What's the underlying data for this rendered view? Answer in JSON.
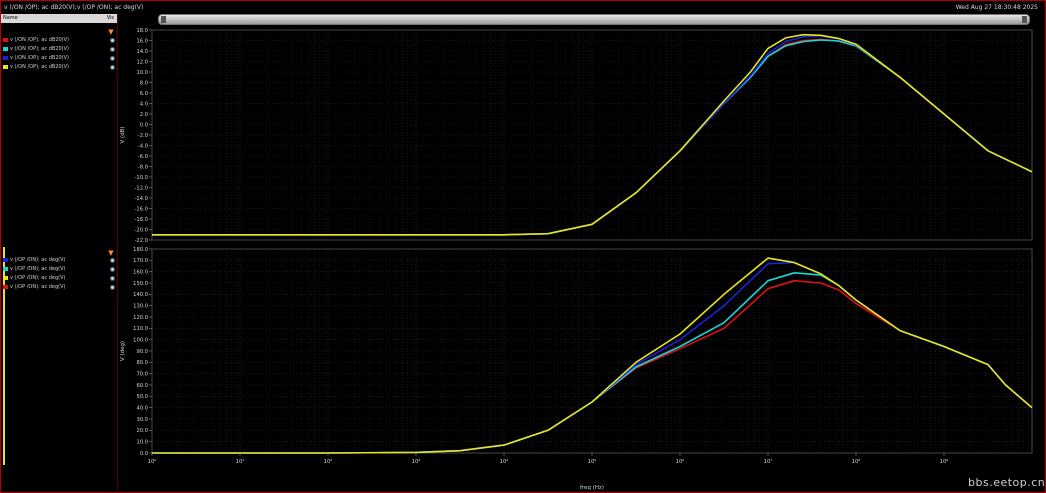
{
  "window": {
    "title": "v (/ON /OP); ac dB20(V);v (/OP /ON); ac deg(V)",
    "timestamp": "Wed Aug 27 18:30:48 2025"
  },
  "left_panel": {
    "name_header": "Name",
    "vis_header": "Vis"
  },
  "watermark": "bbs.eetop.cn",
  "legend_top": [
    {
      "label": "v (/ON /OP); ac dB20(V)",
      "color": "#e01010"
    },
    {
      "label": "v (/ON /OP); ac dB20(V)",
      "color": "#18d6d6"
    },
    {
      "label": "v (/ON /OP); ac dB20(V)",
      "color": "#1a22d8"
    },
    {
      "label": "v (/ON /OP); ac dB20(V)",
      "color": "#e6e61a"
    }
  ],
  "legend_bottom": [
    {
      "label": "v (/OP /ON); ac deg(V)",
      "color": "#1a22d8"
    },
    {
      "label": "v (/OP /ON); ac deg(V)",
      "color": "#18d6d6"
    },
    {
      "label": "v (/OP /ON); ac deg(V)",
      "color": "#e6e61a"
    },
    {
      "label": "v (/OP /ON); ac deg(V)",
      "color": "#e01010"
    }
  ],
  "chart_data": [
    {
      "type": "line",
      "ylabel": "V (dB)",
      "ylim": [
        -22,
        18
      ],
      "yticks": [
        "18.0",
        "16.0",
        "14.0",
        "12.0",
        "10.0",
        "8.0",
        "6.0",
        "4.0",
        "2.0",
        "0.0",
        "-2.0",
        "-4.0",
        "-6.0",
        "-8.0",
        "-10.0",
        "-12.0",
        "-14.0",
        "-16.0",
        "-18.0",
        "-20.0",
        "-22.0"
      ],
      "x_scale": "log",
      "xlim_exp": [
        0,
        10
      ],
      "grid": true,
      "series": [
        {
          "color": "#e01010",
          "x_exp": [
            0,
            1,
            2,
            3,
            4,
            4.5,
            5,
            5.5,
            6,
            6.5,
            6.8,
            7,
            7.2,
            7.4,
            7.6,
            7.8,
            8,
            8.5,
            9,
            9.5,
            10
          ],
          "y": [
            -21,
            -21,
            -21,
            -21,
            -21,
            -20.8,
            -19,
            -13,
            -5,
            4,
            9,
            13,
            15.2,
            16.0,
            16.2,
            15.9,
            15.0,
            9,
            2,
            -5,
            -9
          ]
        },
        {
          "color": "#18d6d6",
          "x_exp": [
            0,
            1,
            2,
            3,
            4,
            4.5,
            5,
            5.5,
            6,
            6.5,
            6.8,
            7,
            7.2,
            7.4,
            7.6,
            7.8,
            8,
            8.5,
            9,
            9.5,
            10
          ],
          "y": [
            -21,
            -21,
            -21,
            -21,
            -21,
            -20.8,
            -19,
            -13,
            -5,
            4,
            9,
            13,
            15.0,
            15.8,
            16.1,
            15.9,
            15.0,
            9,
            2,
            -5,
            -9
          ]
        },
        {
          "color": "#1a22d8",
          "x_exp": [
            0,
            1,
            2,
            3,
            4,
            4.5,
            5,
            5.5,
            6,
            6.5,
            6.8,
            7,
            7.2,
            7.4,
            7.6,
            7.8,
            8,
            8.5,
            9,
            9.5,
            10
          ],
          "y": [
            -21,
            -21,
            -21,
            -21,
            -21,
            -20.8,
            -19,
            -13,
            -5,
            4,
            9.3,
            13.5,
            15.8,
            16.7,
            16.9,
            16.3,
            15.2,
            9,
            2,
            -5,
            -9
          ]
        },
        {
          "color": "#e6e61a",
          "x_exp": [
            0,
            1,
            2,
            3,
            4,
            4.5,
            5,
            5.5,
            6,
            6.5,
            6.8,
            7,
            7.2,
            7.4,
            7.6,
            7.8,
            8,
            8.5,
            9,
            9.5,
            10
          ],
          "y": [
            -21,
            -21,
            -21,
            -21,
            -21,
            -20.8,
            -19,
            -13,
            -5,
            4.5,
            10,
            14.5,
            16.5,
            17.1,
            17.0,
            16.4,
            15.3,
            9,
            2,
            -5,
            -9
          ]
        }
      ]
    },
    {
      "type": "line",
      "ylabel": "V (deg)",
      "xlabel": "freq (Hz)",
      "ylim": [
        0,
        180
      ],
      "yticks": [
        "180.0",
        "170.0",
        "160.0",
        "150.0",
        "140.0",
        "130.0",
        "120.0",
        "110.0",
        "100.0",
        "90.0",
        "80.0",
        "70.0",
        "60.0",
        "50.0",
        "40.0",
        "30.0",
        "20.0",
        "10.0",
        "0.0"
      ],
      "x_scale": "log",
      "xlim_exp": [
        0,
        10
      ],
      "xticks": [
        "10⁰",
        "10¹",
        "10²",
        "10³",
        "10⁴",
        "10⁵",
        "10⁶",
        "10⁷",
        "10⁸",
        "10⁹"
      ],
      "grid": true,
      "series": [
        {
          "color": "#e01010",
          "x_exp": [
            0,
            1,
            2,
            3,
            3.5,
            4,
            4.5,
            5,
            5.5,
            6,
            6.5,
            7,
            7.3,
            7.6,
            7.8,
            8,
            8.5,
            9,
            9.5,
            9.7,
            10
          ],
          "y": [
            0,
            0,
            0,
            0.5,
            2,
            7,
            20,
            45,
            75,
            92,
            110,
            145,
            152,
            150,
            144,
            132,
            108,
            94,
            78,
            60,
            40
          ]
        },
        {
          "color": "#18d6d6",
          "x_exp": [
            0,
            1,
            2,
            3,
            3.5,
            4,
            4.5,
            5,
            5.5,
            6,
            6.5,
            7,
            7.3,
            7.6,
            7.8,
            8,
            8.5,
            9,
            9.5,
            9.7,
            10
          ],
          "y": [
            0,
            0,
            0,
            0.5,
            2,
            7,
            20,
            45,
            76,
            94,
            115,
            152,
            159,
            157,
            148,
            135,
            108,
            94,
            78,
            60,
            40
          ]
        },
        {
          "color": "#1a22d8",
          "x_exp": [
            0,
            1,
            2,
            3,
            3.5,
            4,
            4.5,
            5,
            5.5,
            6,
            6.5,
            7,
            7.3,
            7.6,
            7.8,
            8,
            8.5,
            9,
            9.5,
            9.7,
            10
          ],
          "y": [
            0,
            0,
            0,
            0.5,
            2,
            7,
            20,
            45,
            78,
            100,
            130,
            167,
            168,
            158,
            148,
            135,
            108,
            94,
            78,
            60,
            40
          ]
        },
        {
          "color": "#e6e61a",
          "x_exp": [
            0,
            1,
            2,
            3,
            3.5,
            4,
            4.5,
            5,
            5.5,
            6,
            6.5,
            7,
            7.3,
            7.6,
            7.8,
            8,
            8.5,
            9,
            9.5,
            9.7,
            10
          ],
          "y": [
            0,
            0,
            0,
            0.5,
            2,
            7,
            20,
            45,
            80,
            105,
            140,
            172,
            168,
            158,
            148,
            135,
            108,
            94,
            78,
            60,
            40
          ]
        }
      ]
    }
  ]
}
